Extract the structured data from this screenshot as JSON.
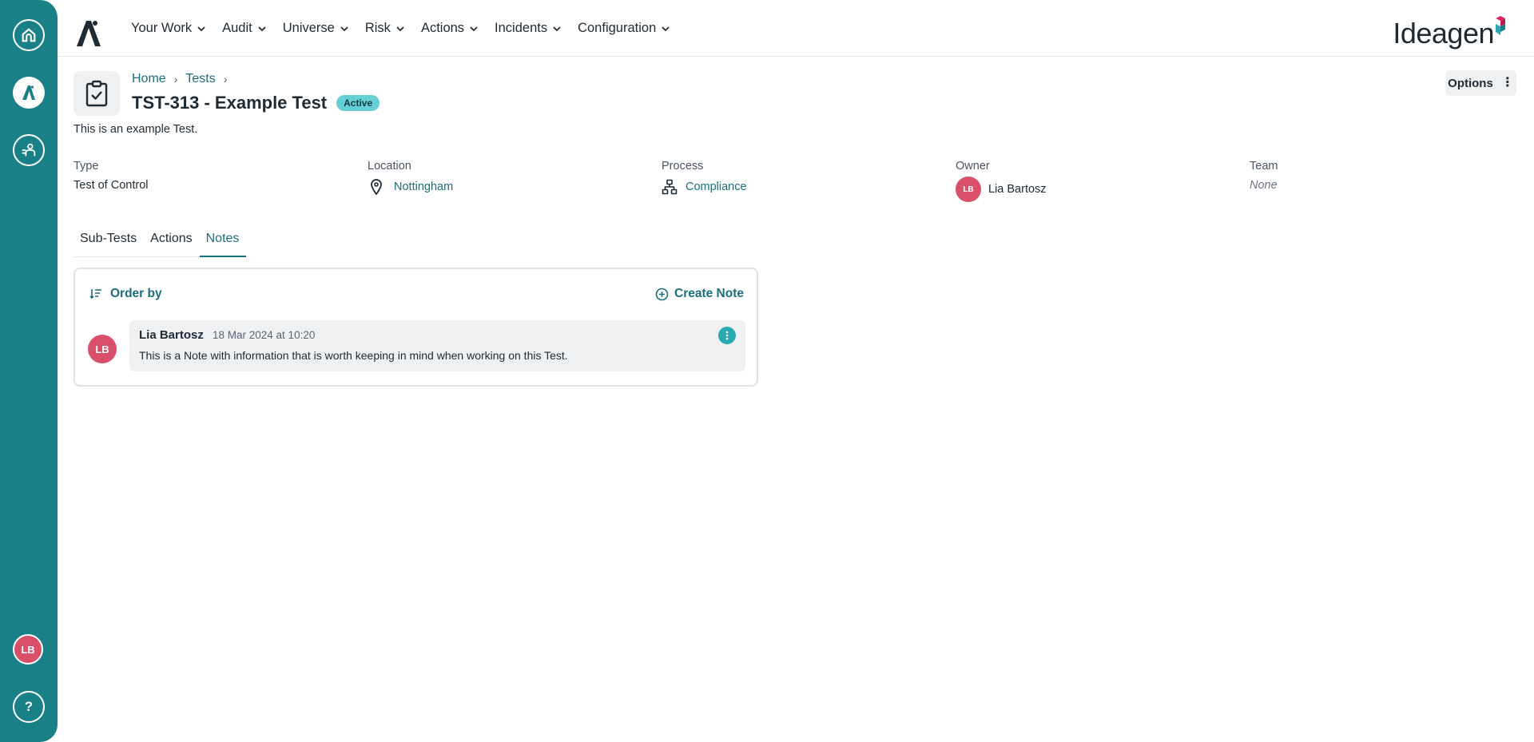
{
  "nav": {
    "menu": [
      {
        "label": "Your Work"
      },
      {
        "label": "Audit"
      },
      {
        "label": "Universe"
      },
      {
        "label": "Risk"
      },
      {
        "label": "Actions"
      },
      {
        "label": "Incidents"
      },
      {
        "label": "Configuration"
      }
    ],
    "brand": "Ideagen"
  },
  "rail": {
    "user_initials": "LB",
    "help_label": "?"
  },
  "header": {
    "breadcrumb": [
      "Home",
      "Tests"
    ],
    "title": "TST-313 - Example Test",
    "status": "Active",
    "description": "This is an example Test.",
    "options_label": "Options"
  },
  "properties": {
    "type": {
      "label": "Type",
      "value": "Test of Control"
    },
    "location": {
      "label": "Location",
      "value": "Nottingham"
    },
    "process": {
      "label": "Process",
      "value": "Compliance"
    },
    "owner": {
      "label": "Owner",
      "value": "Lia Bartosz",
      "initials": "LB"
    },
    "team": {
      "label": "Team",
      "value": "None"
    }
  },
  "tabs": [
    {
      "label": "Sub-Tests"
    },
    {
      "label": "Actions"
    },
    {
      "label": "Notes"
    }
  ],
  "notes": {
    "order_by_label": "Order by",
    "create_label": "Create Note",
    "items": [
      {
        "initials": "LB",
        "author": "Lia Bartosz",
        "timestamp": "18 Mar 2024 at 10:20",
        "body": "This is a Note with information that is worth keeping in mind when working on this Test."
      }
    ]
  },
  "colors": {
    "rail": "#1a8087",
    "accent": "#1a6f7a",
    "avatar": "#d94f6a",
    "status_badge": "#66cfd6"
  }
}
